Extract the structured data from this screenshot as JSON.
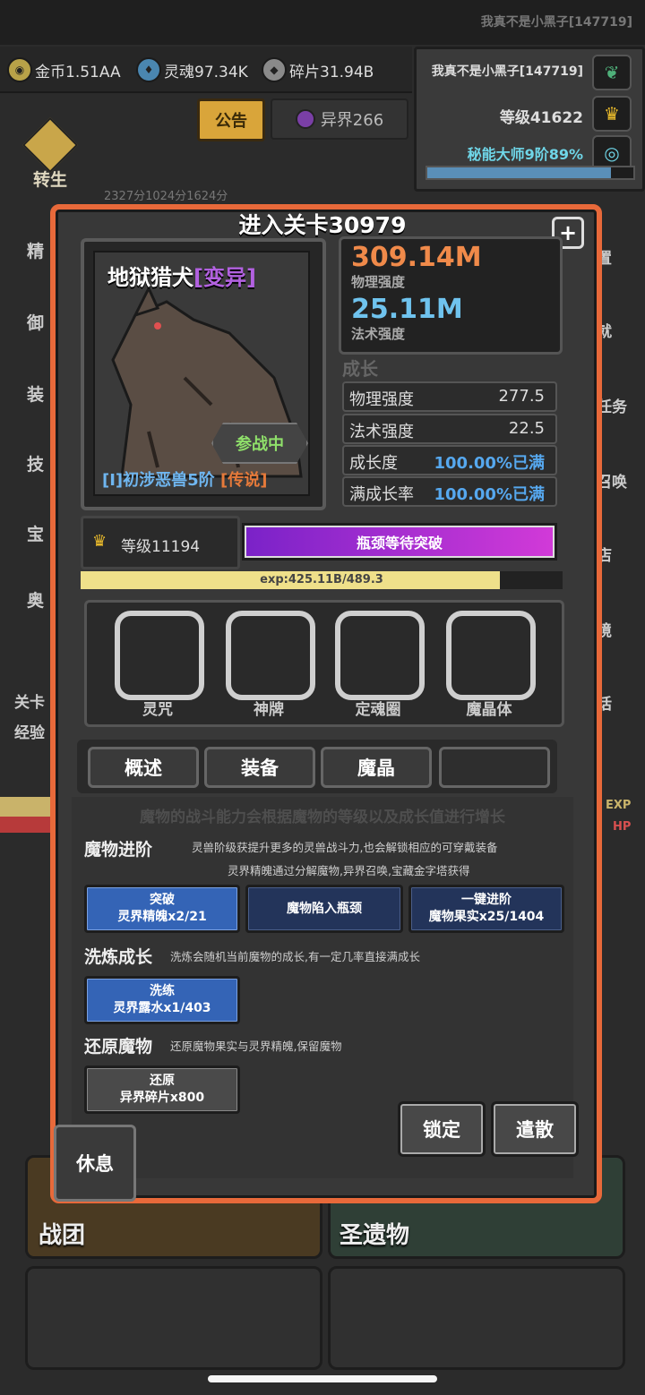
{
  "header": {
    "player_title": "我真不是小黑子[147719]"
  },
  "resources": [
    {
      "icon": "coin-icon",
      "label": "金币1.51AA"
    },
    {
      "icon": "soul-icon",
      "label": "灵魂97.34K"
    },
    {
      "icon": "shard-icon",
      "label": "碎片31.94B"
    }
  ],
  "player_panel": {
    "name": "我真不是小黑子[147719]",
    "level": "等级41622",
    "mastery": "秘能大师9阶89%",
    "mastery_progress": 0.89
  },
  "top_buttons": {
    "notice": "公告",
    "otherworld": "异界266"
  },
  "background": {
    "rebirth": "转生",
    "faded_stats": "2327分1024分1624分",
    "left_icons": [
      "精",
      "御",
      "装",
      "技",
      "宝",
      "奥"
    ],
    "right_icons": [
      "置",
      "就",
      "任务",
      "召唤",
      "店",
      "境",
      "话"
    ],
    "left_labels": [
      "关卡",
      "经验"
    ],
    "side_tags": [
      "EXP",
      "HP"
    ],
    "bottom_cards": [
      "战团",
      "圣遗物"
    ]
  },
  "dialog": {
    "title": "进入关卡30979",
    "plus_label": "+",
    "monster": {
      "name": "地狱猎犬",
      "mutation": "[变异]",
      "status": "参战中",
      "rank": "[I]初涉恶兽5阶",
      "rarity": "[传说]"
    },
    "power": {
      "physical_value": "309.14M",
      "physical_label": "物理强度",
      "magic_value": "25.11M",
      "magic_label": "法术强度"
    },
    "growth": {
      "title": "成长",
      "rows": [
        {
          "label": "物理强度",
          "value": "277.5"
        },
        {
          "label": "法术强度",
          "value": "22.5"
        },
        {
          "label": "成长度",
          "value": "100.00%已满"
        },
        {
          "label": "满成长率",
          "value": "100.00%已满"
        }
      ]
    },
    "level": "等级11194",
    "bottleneck": "瓶颈等待突破",
    "exp_text": "exp:425.11B/489.3",
    "exp_progress": 0.87,
    "slots": [
      "灵咒",
      "神牌",
      "定魂圈",
      "魔晶体"
    ],
    "tabs": [
      "概述",
      "装备",
      "魔晶",
      ""
    ],
    "hint": "魔物的战斗能力会根据魔物的等级以及成长值进行增长",
    "advance": {
      "title": "魔物进阶",
      "desc1": "灵兽阶级获提升更多的灵兽战斗力,也会解锁相应的可穿戴装备",
      "desc2": "灵界精魄通过分解魔物,异界召唤,宝藏金字塔获得",
      "btn_breakthrough": {
        "line1": "突破",
        "line2": "灵界精魄x2/21"
      },
      "btn_bottleneck": "魔物陷入瓶颈",
      "btn_onekey": {
        "line1": "一键进阶",
        "line2": "魔物果实x25/1404"
      }
    },
    "refine": {
      "title": "洗炼成长",
      "desc": "洗炼会随机当前魔物的成长,有一定几率直接满成长",
      "btn": {
        "line1": "洗练",
        "line2": "灵界露水x1/403"
      }
    },
    "restore": {
      "title": "还原魔物",
      "desc": "还原魔物果实与灵界精魄,保留魔物",
      "btn": {
        "line1": "还原",
        "line2": "异界碎片x800"
      }
    },
    "lock": "锁定",
    "dismiss": "遣散",
    "rest": "休息"
  },
  "colors": {
    "dialog_border": "#e8693a",
    "accent_blue": "#3464b6",
    "physical": "#f08a4a",
    "magic": "#6fc3ee",
    "bottleneck": "#c232d6"
  }
}
